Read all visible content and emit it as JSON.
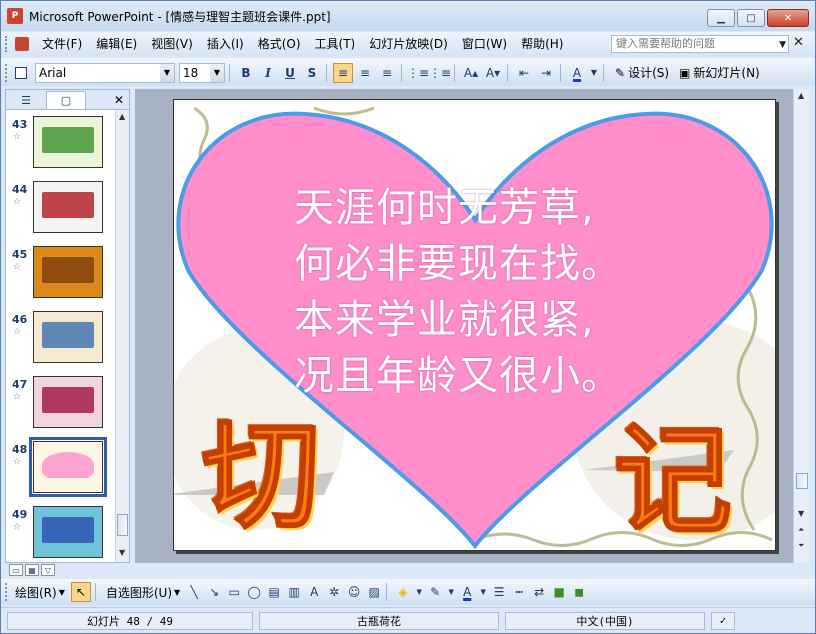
{
  "window": {
    "title": "Microsoft PowerPoint - [情感与理智主题班会课件.ppt]",
    "app_icon_letter": "P"
  },
  "menu": {
    "items": [
      "文件(F)",
      "编辑(E)",
      "视图(V)",
      "插入(I)",
      "格式(O)",
      "工具(T)",
      "幻灯片放映(D)",
      "窗口(W)",
      "帮助(H)"
    ],
    "help_placeholder": "键入需要帮助的问题"
  },
  "toolbar": {
    "font_name": "Arial",
    "font_size": "18",
    "bold": "B",
    "italic": "I",
    "underline": "U",
    "shadow": "S",
    "design_label": "设计(S)",
    "new_slide_label": "新幻灯片(N)"
  },
  "slides_panel": {
    "slides": [
      {
        "number": "43",
        "bg": "#eaf4d8",
        "accent": "#3a8f2a"
      },
      {
        "number": "44",
        "bg": "#f4f4f4",
        "accent": "#b0181e"
      },
      {
        "number": "45",
        "bg": "#d98a1a",
        "accent": "#7a3d0a"
      },
      {
        "number": "46",
        "bg": "#f7e8d0",
        "accent": "#3a6fb0"
      },
      {
        "number": "47",
        "bg": "#f2d4dc",
        "accent": "#a01040"
      },
      {
        "number": "48",
        "bg": "#fff7e6",
        "accent": "#ff8ecb",
        "selected": true
      },
      {
        "number": "49",
        "bg": "#6fc3d8",
        "accent": "#2a4fb0"
      }
    ]
  },
  "slide": {
    "lines": [
      "天涯何时无芳草,",
      "何必非要现在找。",
      "本来学业就很紧,",
      "况且年龄又很小。"
    ],
    "left_char": "切",
    "right_char": "记",
    "heart_color": "#ff8ecb",
    "heart_outline": "#4a9be8"
  },
  "drawing_toolbar": {
    "draw_label": "绘图(R)",
    "autoshapes_label": "自选图形(U)"
  },
  "status": {
    "slide_position": "幻灯片 48 / 49",
    "design_name": "古瓶荷花",
    "language": "中文(中国)"
  }
}
